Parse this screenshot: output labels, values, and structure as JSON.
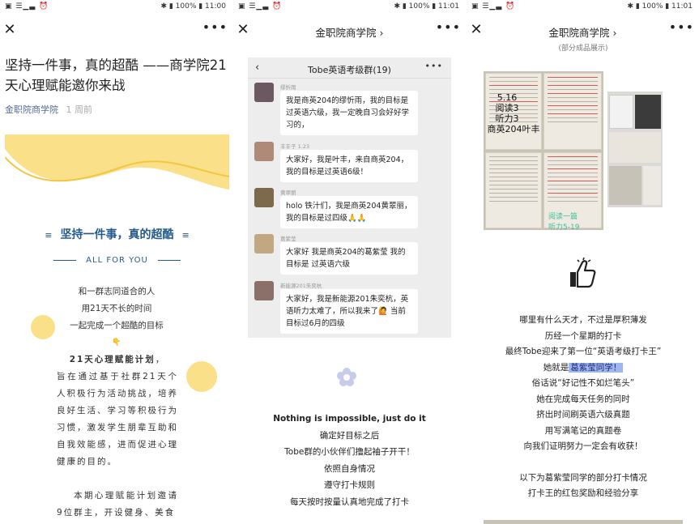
{
  "status": {
    "left": "▣ ☰▁▃ ⏰",
    "p1_right": "✱ ▮ 100% ▮ 11:00",
    "p2_right": "✱ ▮ 100% ▮ 11:01",
    "p3_right": "✱ ▮ 100% ▮ 11:01"
  },
  "nav": {
    "close": "✕",
    "more": "•••",
    "account_title": "金职院商学院 ›"
  },
  "article": {
    "title": "坚持一件事，真的超酷 ——商学院21天心理赋能邀你来战",
    "account": "金职院商学院",
    "time": "1 周前",
    "heading": "坚持一件事，真的超酷",
    "heading_bars": "≡",
    "subheading": "ALL FOR YOU",
    "intro_lines": [
      "和一群志同道合的人",
      "用21天不长的时间",
      "一起完成一个超酷的目标"
    ],
    "hand": "👇",
    "plan_name": "21天心理赋能计划",
    "plan_tail": "，",
    "plan_text": "旨在通过基于社群21天个人积极行为活动挑战，培养良好生活、学习等积极行为习惯，激发学生朋辈互助和自我效能感，进而促进心理健康的目的。",
    "para2": "本期心理赋能计划邀请9位群主，开设健身、美食"
  },
  "chat": {
    "back": "‹",
    "title": "Tobe英语考级群(19)",
    "more": "•••",
    "messages": [
      {
        "sender": "缪忻雨",
        "text": "我是商英204的缪忻雨，我的目标是过英语六级，我一定晚自习会好好学习的，",
        "avatar": "#6b5860"
      },
      {
        "sender": "丰丰子 1.23",
        "text": "大家好，我是叶丰，来自商英204，我的目标是过英语6级！",
        "avatar": "#b08a78"
      },
      {
        "sender": "黄翠丽",
        "text": "holo 铁汁们，我是商英204黄翠丽，我的目标是过四级🙏🙏",
        "avatar": "#7d6a4c"
      },
      {
        "sender": "葛紫莹",
        "text": "大家好 我是商英204的葛紫莹 我的目标是 过英语六级",
        "avatar": "#c1a882"
      },
      {
        "sender": "新能源201朱奕杭",
        "text": "大家好，我是新能源201朱奕杭，英语听力太难了，所以我来了🙋 当前目标过6月的四级",
        "avatar": "#8a7068"
      }
    ]
  },
  "p2_lines": {
    "bold": "Nothing is impossible, just do it",
    "lines": [
      "确定好目标之后",
      "Tobe群的小伙伴们撸起袖子开干！",
      "依照自身情况",
      "遵守打卡规则",
      "每天按时按量认真地完成了打卡"
    ]
  },
  "p3": {
    "top_caption": "(部分成品展示)",
    "overlay": [
      "5.16",
      "阅读3",
      "听力3",
      "商英204叶丰"
    ],
    "green_caption": [
      "阅读一篇",
      "听力5-19"
    ],
    "lines_before": [
      "哪里有什么天才，不过是厚积薄发",
      "历经一个星期的打卡",
      "最终Tobe迎来了第一位“英语考级打卡王”"
    ],
    "she_is": "她就是",
    "highlight": "葛紫莹同学！",
    "lines_after": [
      "俗话说“好记性不如烂笔头”",
      "她在完成每天任务的同时",
      "挤出时间刷英语六级真题",
      "用写满笔记的真题卷",
      "向我们证明努力一定会有收获！"
    ],
    "lines_end": [
      "以下为葛紫莹同学的部分打卡情况",
      "打卡王的红包奖励和经验分享"
    ]
  },
  "colors": {
    "link": "#576b95",
    "heading": "#245a8c",
    "banner_yellow": "#fbe08a",
    "highlight": "#9fb6ef"
  }
}
